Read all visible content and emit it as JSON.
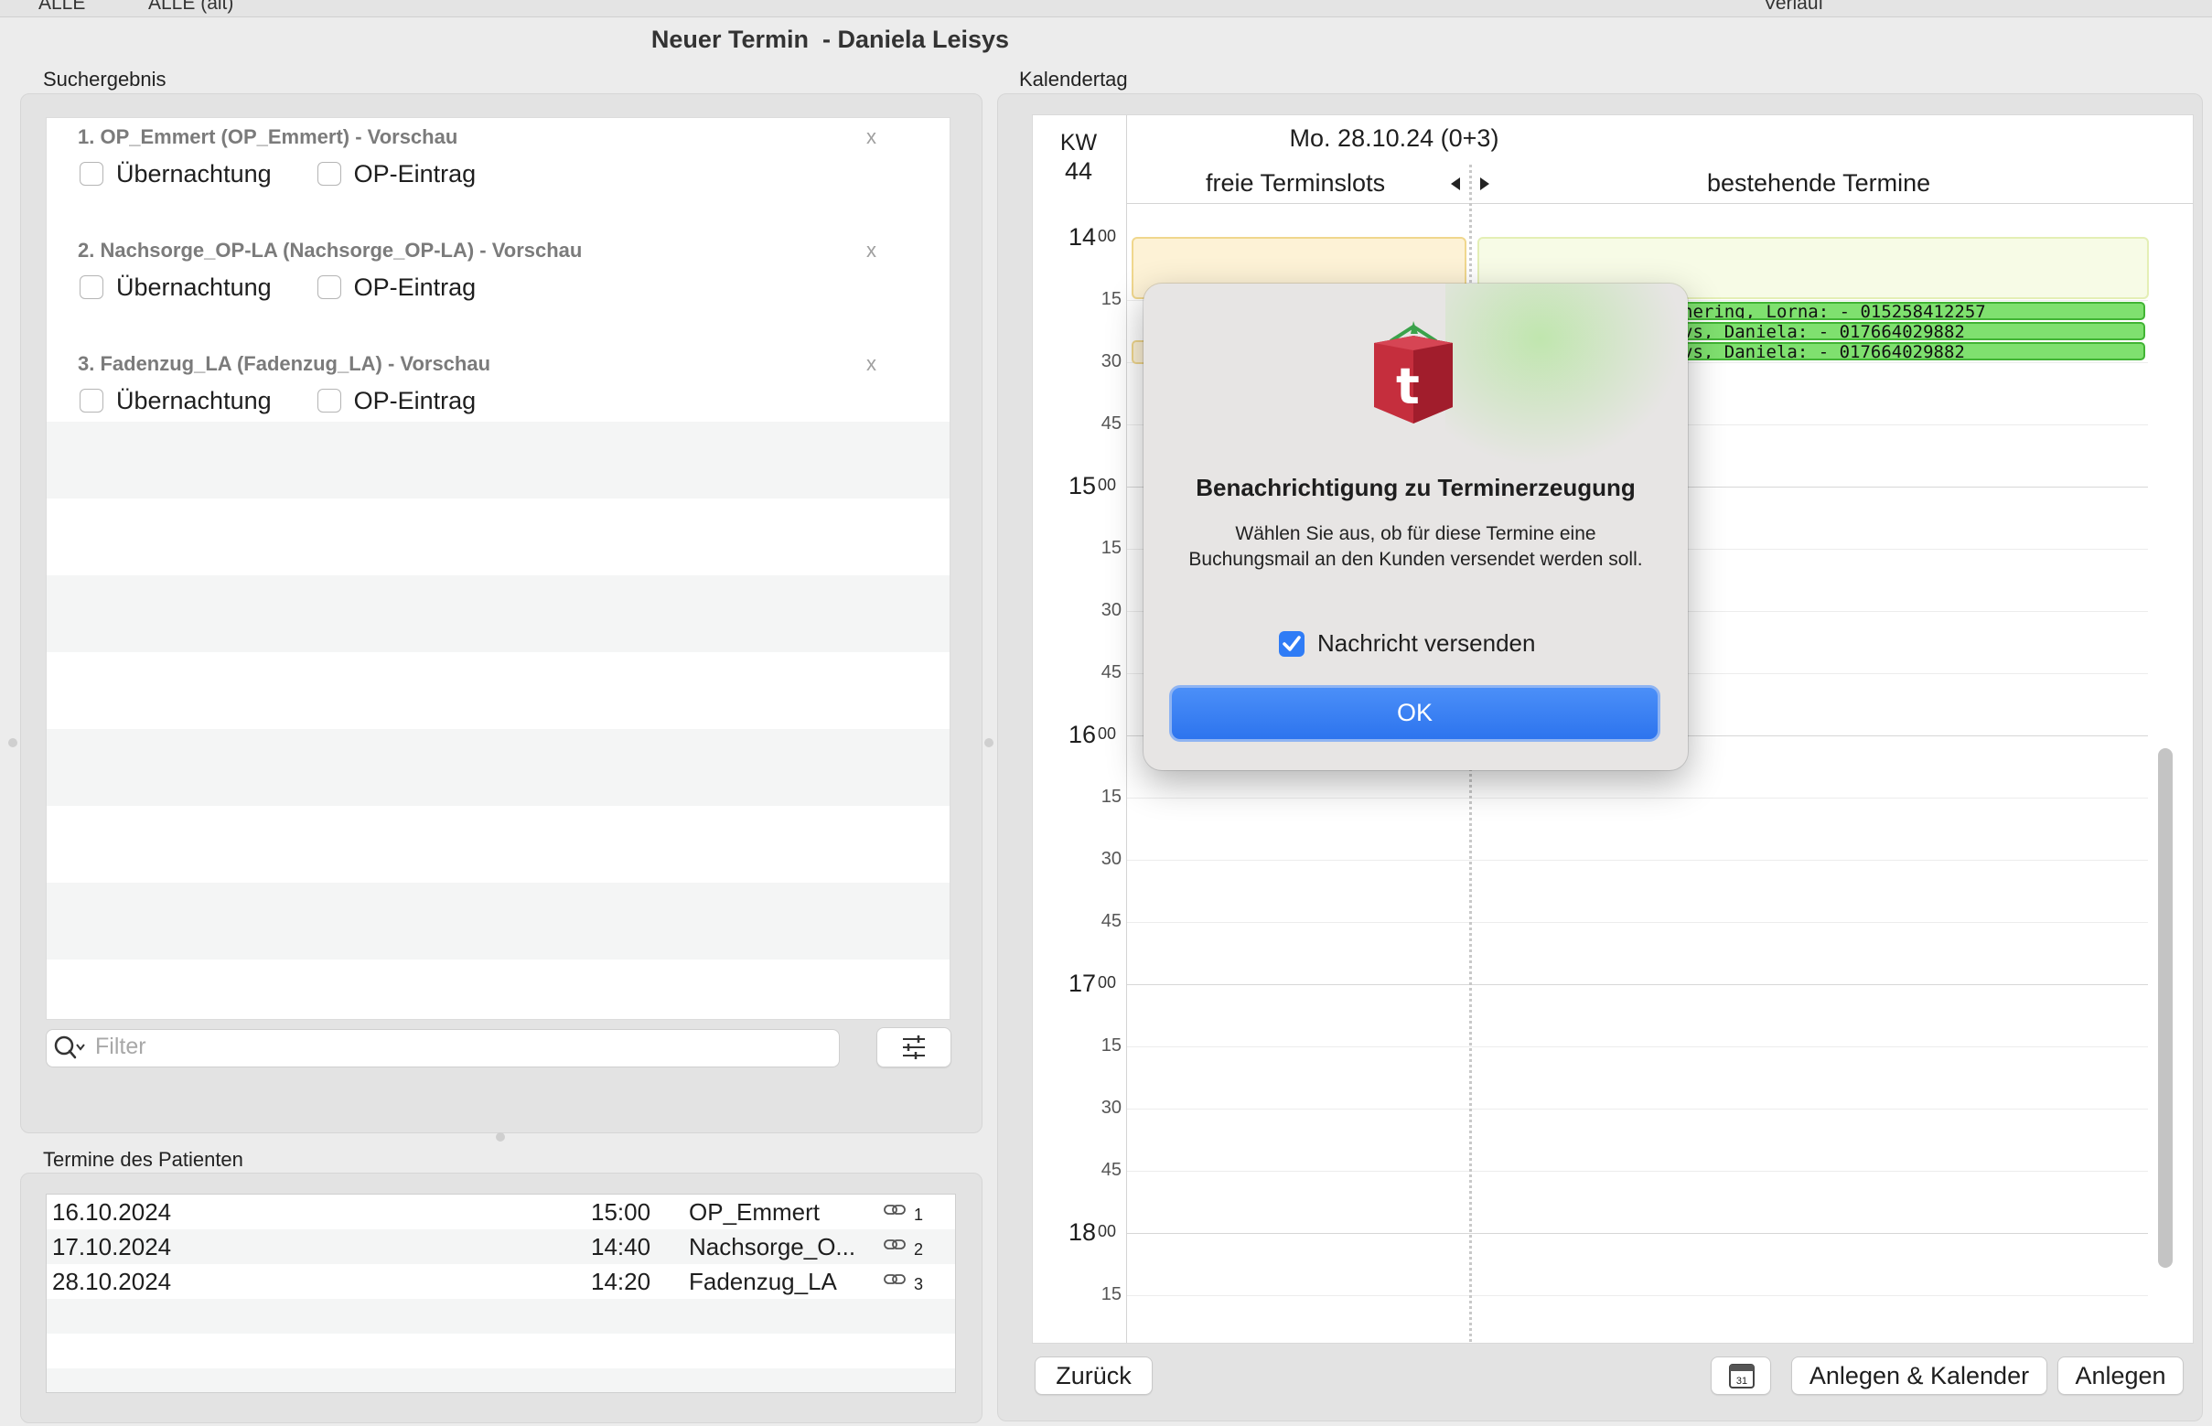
{
  "top_strip": {
    "left_text1": "ALLE",
    "left_text2": "ALLE (alt)",
    "right_text": "Verlauf"
  },
  "window": {
    "title": "Neuer Termin  - Daniela Leisys"
  },
  "search": {
    "section_label": "Suchergebnis",
    "results": [
      {
        "title": "1. OP_Emmert (OP_Emmert) - Vorschau",
        "close": "x",
        "overnight_label": "Übernachtung",
        "op_label": "OP-Eintrag"
      },
      {
        "title": "2. Nachsorge_OP-LA (Nachsorge_OP-LA) - Vorschau",
        "close": "x",
        "overnight_label": "Übernachtung",
        "op_label": "OP-Eintrag"
      },
      {
        "title": "3. Fadenzug_LA (Fadenzug_LA) - Vorschau",
        "close": "x",
        "overnight_label": "Übernachtung",
        "op_label": "OP-Eintrag"
      }
    ],
    "filter_placeholder": "Filter"
  },
  "patient_appointments": {
    "section_label": "Termine des Patienten",
    "rows": [
      {
        "date": "16.10.2024",
        "time": "15:00",
        "name": "OP_Emmert",
        "num": "1"
      },
      {
        "date": "17.10.2024",
        "time": "14:40",
        "name": "Nachsorge_O...",
        "num": "2"
      },
      {
        "date": "28.10.2024",
        "time": "14:20",
        "name": "Fadenzug_LA",
        "num": "3"
      }
    ]
  },
  "calendar": {
    "section_label": "Kalendertag",
    "kw_label": "KW",
    "kw_number": "44",
    "date": "Mo. 28.10.24 (0+3)",
    "free_slots_label": "freie Terminslots",
    "existing_label": "bestehende Termine",
    "hours": [
      {
        "hour": "14",
        "minutes": "00",
        "quarters": [
          "15",
          "30",
          "45"
        ]
      },
      {
        "hour": "15",
        "minutes": "00",
        "quarters": [
          "15",
          "30",
          "45"
        ]
      },
      {
        "hour": "16",
        "minutes": "00",
        "quarters": [
          "15",
          "30",
          "45"
        ]
      },
      {
        "hour": "17",
        "minutes": "00",
        "quarters": [
          "15",
          "30",
          "45"
        ]
      },
      {
        "hour": "18",
        "minutes": "00",
        "quarters": [
          "15"
        ]
      }
    ],
    "appointments": [
      "hering, Lorna:  - 015258412257",
      "vs, Daniela:  - 017664029882",
      "vs, Daniela:  - 017664029882"
    ],
    "colors": {
      "free_slot": "#fdf2d6",
      "existing": "#f7fbe6",
      "appointment": "#7fe06f"
    }
  },
  "buttons": {
    "back": "Zurück",
    "calendar_icon_day": "31",
    "create_and_calendar": "Anlegen & Kalender",
    "create": "Anlegen"
  },
  "dialog": {
    "icon": "app-logo-icon",
    "icon_letter": "t",
    "title": "Benachrichtigung zu Terminerzeugung",
    "message": "Wählen Sie aus, ob für diese Termine eine Buchungsmail an den Kunden versendet werden soll.",
    "checkbox_label": "Nachricht versenden",
    "checkbox_checked": true,
    "ok": "OK",
    "accent": "#2f7cf6"
  }
}
